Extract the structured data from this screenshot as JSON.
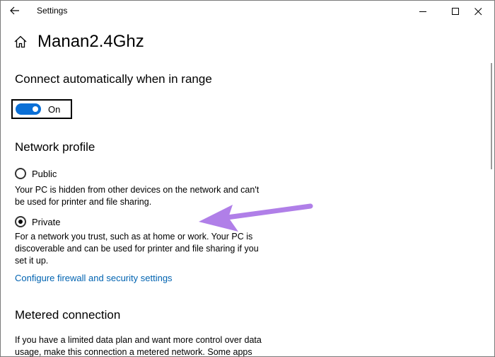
{
  "window": {
    "title": "Settings"
  },
  "header": {
    "title": "Manan2.4Ghz"
  },
  "connect": {
    "title": "Connect automatically when in range",
    "toggle_state": "On"
  },
  "profile": {
    "title": "Network profile",
    "public_label": "Public",
    "public_desc": "Your PC is hidden from other devices on the network and can't be used for printer and file sharing.",
    "private_label": "Private",
    "private_desc": "For a network you trust, such as at home or work. Your PC is discoverable and can be used for printer and file sharing if you set it up.",
    "selected": "Private",
    "firewall_link": "Configure firewall and security settings"
  },
  "metered": {
    "title": "Metered connection",
    "desc": "If you have a limited data plan and want more control over data usage, make this connection a metered network. Some apps might"
  },
  "colors": {
    "accent": "#0a6fd6",
    "link": "#0063b1",
    "annotation_arrow": "#b07fe8"
  },
  "icons": {
    "back": "arrow-left-icon",
    "home": "home-icon",
    "minimize": "minimize-icon",
    "maximize": "maximize-icon",
    "close": "close-icon"
  }
}
